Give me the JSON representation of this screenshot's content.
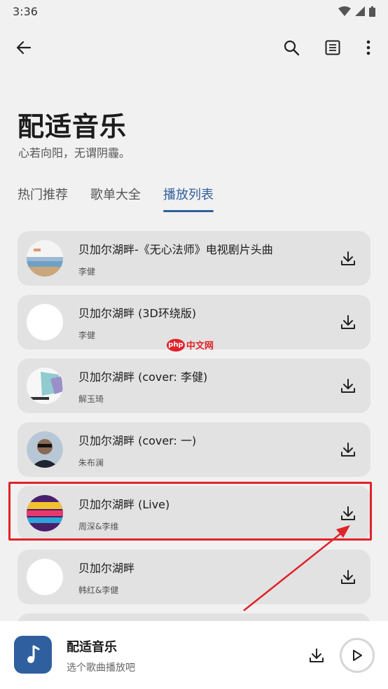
{
  "status_bar": {
    "time": "3:36"
  },
  "appbar": {
    "back_icon": "arrow-back-icon",
    "search_icon": "search-icon",
    "list_icon": "list-icon",
    "more_icon": "more-vert-icon"
  },
  "header": {
    "title": "配适音乐",
    "subtitle": "心若向阳，无谓阴霾。"
  },
  "tabs": [
    {
      "label": "热门推荐",
      "active": false
    },
    {
      "label": "歌单大全",
      "active": false
    },
    {
      "label": "播放列表",
      "active": true
    }
  ],
  "songs": [
    {
      "title": "贝加尔湖畔-《无心法师》电视剧片头曲",
      "artist": "李健"
    },
    {
      "title": "贝加尔湖畔 (3D环绕版)",
      "artist": "李健"
    },
    {
      "title": "贝加尔湖畔 (cover: 李健)",
      "artist": "解玉琦"
    },
    {
      "title": "贝加尔湖畔 (cover: 一)",
      "artist": "朱布澜"
    },
    {
      "title": "贝加尔湖畔 (Live)",
      "artist": "周深&李维"
    },
    {
      "title": "贝加尔湖畔",
      "artist": "韩红&李健"
    }
  ],
  "watermark": {
    "php": "php",
    "cn": "中文网"
  },
  "player": {
    "title": "配适音乐",
    "subtitle": "选个歌曲播放吧"
  },
  "colors": {
    "accent": "#2f5f9e",
    "highlight": "#e0222a",
    "card": "#e2e2e2",
    "background": "#f1f1f1"
  }
}
